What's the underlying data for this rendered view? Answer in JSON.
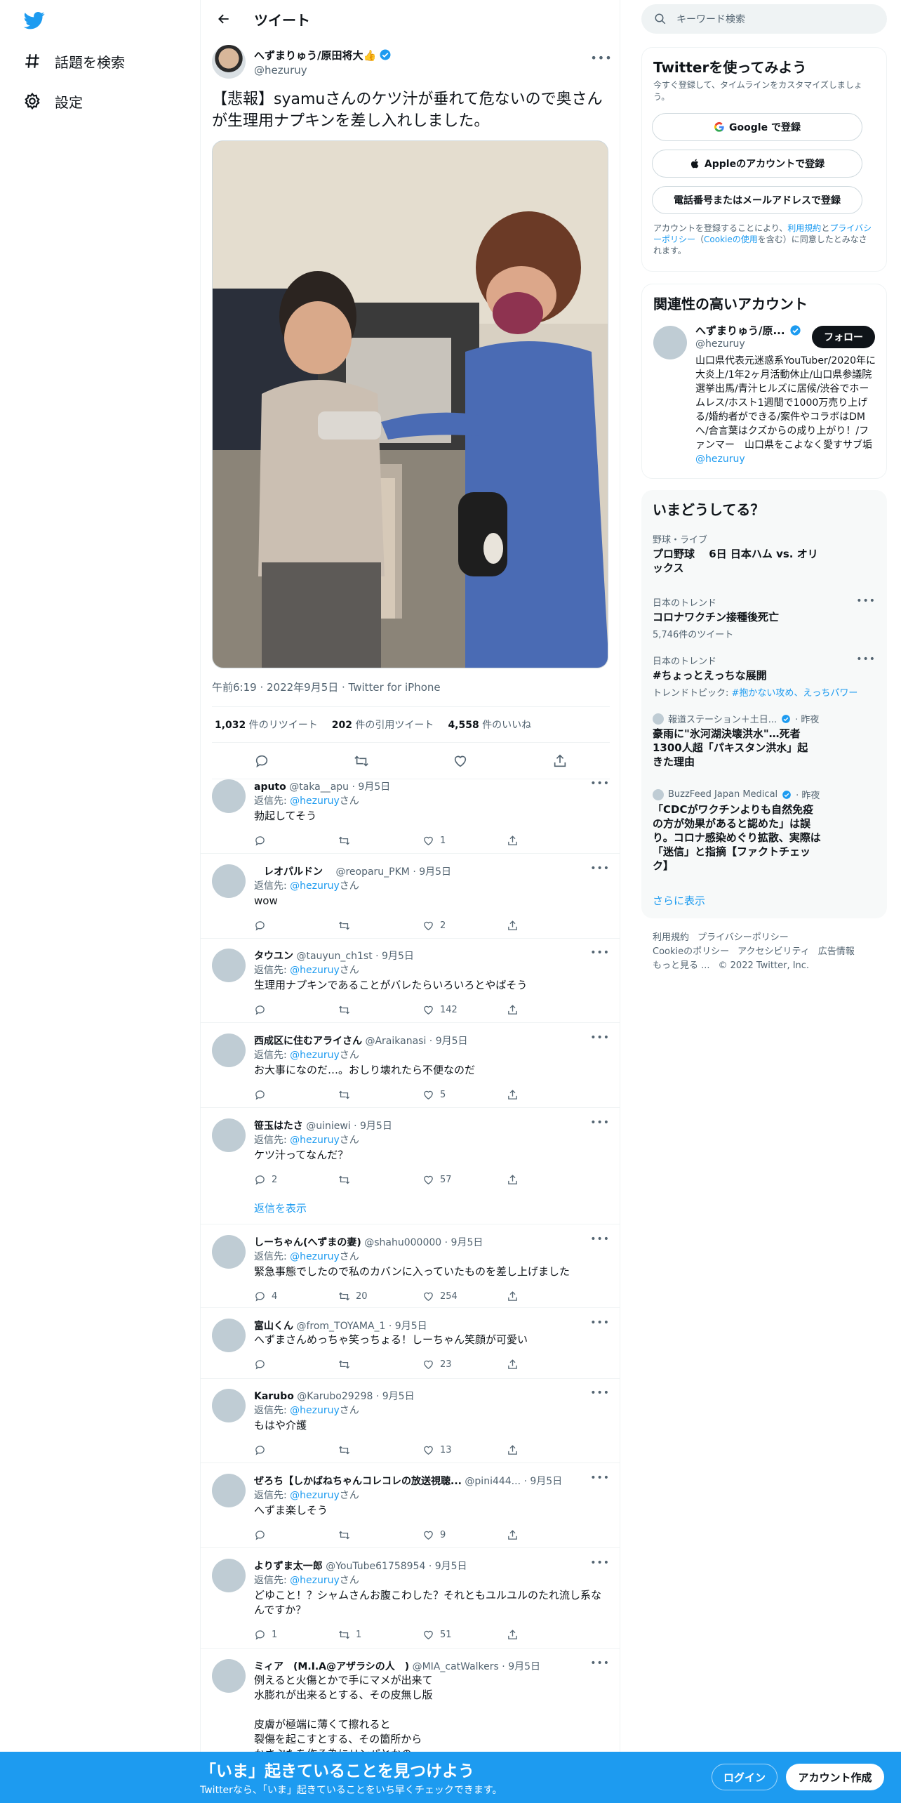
{
  "nav": {
    "explore_label": "話題を検索",
    "settings_label": "設定"
  },
  "header": {
    "title": "ツイート"
  },
  "tweet": {
    "author_name": "へずまりゅう/原田将大👍",
    "author_handle": "@hezuruy",
    "text": "【悲報】syamuさんのケツ汁が垂れて危ないので奥さんが生理用ナプキンを差し入れしました。",
    "meta": "午前6:19 · 2022年9月5日 · Twitter for iPhone",
    "retweets": "1,032",
    "retweets_label": "件のリツイート",
    "quotes": "202",
    "quotes_label": "件の引用ツイート",
    "likes": "4,558",
    "likes_label": "件のいいね"
  },
  "replies": [
    {
      "name": "aputo",
      "handle": "@taka__apu",
      "date": "· 9月5日",
      "to_prefix": "返信先:",
      "to": "@hezuruy",
      "to_suffix": "さん",
      "text": "勃起してそう",
      "reply_count": "",
      "rt_count": "",
      "like_count": "1"
    },
    {
      "name": "　レオパルドン　",
      "handle": "@reoparu_PKM",
      "date": "· 9月5日",
      "to_prefix": "返信先:",
      "to": "@hezuruy",
      "to_suffix": "さん",
      "text": "wow",
      "reply_count": "",
      "rt_count": "",
      "like_count": "2"
    },
    {
      "name": "タウユン",
      "handle": "@tauyun_ch1st",
      "date": "· 9月5日",
      "to_prefix": "返信先:",
      "to": "@hezuruy",
      "to_suffix": "さん",
      "text": "生理用ナプキンであることがバレたらいろいろとやばそう",
      "reply_count": "",
      "rt_count": "",
      "like_count": "142"
    },
    {
      "name": "西成区に住むアライさん",
      "handle": "@Araikanasi",
      "date": "· 9月5日",
      "to_prefix": "返信先:",
      "to": "@hezuruy",
      "to_suffix": "さん",
      "text": "お大事になのだ…。おしり壊れたら不便なのだ",
      "reply_count": "",
      "rt_count": "",
      "like_count": "5"
    },
    {
      "name": "笹玉はたさ",
      "handle": "@uiniewi",
      "date": "· 9月5日",
      "to_prefix": "返信先:",
      "to": "@hezuruy",
      "to_suffix": "さん",
      "text": "ケツ汁ってなんだ？",
      "reply_count": "2",
      "rt_count": "",
      "like_count": "57"
    },
    {
      "name": "しーちゃん(へずまの妻)",
      "handle": "@shahu000000",
      "date": "· 9月5日",
      "to_prefix": "返信先:",
      "to": "@hezuruy",
      "to_suffix": "さん",
      "text": "緊急事態でしたので私のカバンに入っていたものを差し上げました",
      "reply_count": "4",
      "rt_count": "20",
      "like_count": "254"
    },
    {
      "name": "富山くん",
      "handle": "@from_TOYAMA_1",
      "date": "· 9月5日",
      "to_prefix": "",
      "to": "",
      "to_suffix": "",
      "text": "へずまさんめっちゃ笑っちょる！しーちゃん笑顔が可愛い",
      "reply_count": "",
      "rt_count": "",
      "like_count": "23"
    },
    {
      "name": "Karubo",
      "handle": "@Karubo29298",
      "date": "· 9月5日",
      "to_prefix": "返信先:",
      "to": "@hezuruy",
      "to_suffix": "さん",
      "text": "もはや介護",
      "reply_count": "",
      "rt_count": "",
      "like_count": "13"
    },
    {
      "name": "ぜろち【しかばねちゃんコレコレの放送視聴...",
      "handle": "@pini444...",
      "date": "· 9月5日",
      "to_prefix": "返信先:",
      "to": "@hezuruy",
      "to_suffix": "さん",
      "text": "へずま楽しそう",
      "reply_count": "",
      "rt_count": "",
      "like_count": "9"
    },
    {
      "name": "よりずま太一郎",
      "handle": "@YouTube61758954",
      "date": "· 9月5日",
      "to_prefix": "返信先:",
      "to": "@hezuruy",
      "to_suffix": "さん",
      "text": "どゆこと！？シャムさんお腹こわした？それともユルユルのたれ流し系なんですか？",
      "reply_count": "1",
      "rt_count": "1",
      "like_count": "51"
    },
    {
      "name": "ミィア　(M.I.A@アザラシの人　)",
      "handle": "@MIA_catWalkers",
      "date": "· 9月5日",
      "to_prefix": "",
      "to": "",
      "to_suffix": "",
      "text": "例えると火傷とかで手にマメが出来て\n水膨れが出来るとする、その皮無し版\n\n皮膚が極端に薄くて擦れると\n裂傷を起こすとする、その箇所から\nかさぶたを作る為にリンパとかの",
      "reply_count": "",
      "rt_count": "",
      "like_count": ""
    }
  ],
  "show_replies_label": "返信を表示",
  "right": {
    "search_placeholder": "キーワード検索",
    "signup": {
      "title": "Twitterを使ってみよう",
      "subtitle": "今すぐ登録して、タイムラインをカスタマイズしましょう。",
      "google": "Google で登録",
      "apple": "Appleのアカウントで登録",
      "phone": "電話番号またはメールアドレスで登録",
      "legal_1": "アカウントを登録することにより、",
      "legal_link_1": "利用規約",
      "legal_2": "と",
      "legal_link_2": "プライバシーポリシー",
      "legal_3": "（",
      "legal_link_3": "Cookieの使用",
      "legal_4": "を含む）に同意したとみなされます。"
    },
    "related": {
      "title": "関連性の高いアカウント",
      "name": "へずまりゅう/原...",
      "handle": "@hezuruy",
      "follow": "フォロー",
      "bio": "山口県代表元迷惑系YouTuber/2020年に大炎上/1年2ヶ月活動休止/山口県参議院選挙出馬/青汁ヒルズに居候/渋谷でホームレス/ホスト1週間で1000万売り上げる/婚約者ができる/案件やコラボはDMへ/合言葉はクズからの成り上がり！/ファンマー　山口県をこよなく愛すサブ垢",
      "bio_link": "@hezuruy"
    },
    "trends": {
      "title": "いまどうしてる？",
      "items": [
        {
          "context": "野球・ライブ",
          "title": "プロ野球　 6日 日本ハム vs. オリックス",
          "sub": ""
        },
        {
          "context": "日本のトレンド",
          "title": "コロナワクチン接種後死亡",
          "sub": "5,746件のツイート"
        },
        {
          "context": "日本のトレンド",
          "title": "#ちょっとえっちな展開",
          "sub_prefix": "トレンドトピック: ",
          "sub_link": "#抱かない攻め、えっちパワー"
        }
      ],
      "news": [
        {
          "source": "報道ステーション＋土日...",
          "time": "· 昨夜",
          "title": "豪雨に\"氷河湖決壊洪水\"…死者1300人超「パキスタン洪水」起きた理由"
        },
        {
          "source": "BuzzFeed Japan Medical",
          "time": "· 昨夜",
          "title": "「CDCがワクチンよりも自然免疫の方が効果があると認めた」は誤り。コロナ感染めぐり拡散、実際は「迷信」と指摘【ファクトチェック】"
        }
      ],
      "show_more": "さらに表示"
    },
    "footer": {
      "terms": "利用規約",
      "privacy": "プライバシーポリシー",
      "cookie": "Cookieのポリシー",
      "accessibility": "アクセシビリティ",
      "ads": "広告情報",
      "more": "もっと見る ...",
      "copyright": "© 2022 Twitter, Inc."
    }
  },
  "banner": {
    "title": "「いま」起きていることを見つけよう",
    "subtitle": "Twitterなら、「いま」起きていることをいち早くチェックできます。",
    "login": "ログイン",
    "signup": "アカウント作成"
  },
  "colors": {
    "accent": "#1d9bf0",
    "text": "#0f1419",
    "muted": "#536471"
  }
}
